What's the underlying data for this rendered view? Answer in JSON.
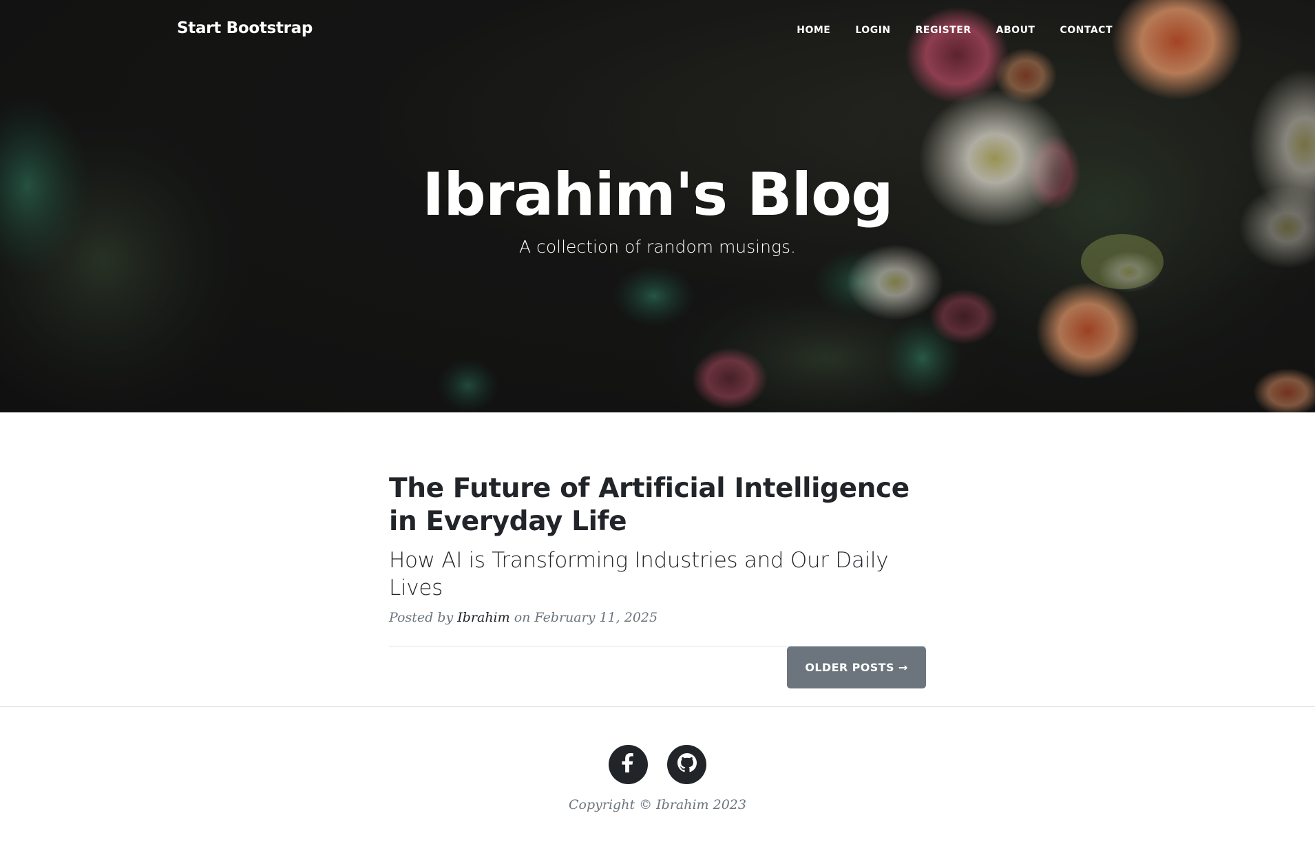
{
  "navbar": {
    "brand": "Start Bootstrap",
    "links": [
      "HOME",
      "LOGIN",
      "REGISTER",
      "ABOUT",
      "CONTACT"
    ]
  },
  "hero": {
    "title": "Ibrahim's Blog",
    "subtitle": "A collection of random musings."
  },
  "posts": [
    {
      "title": "The Future of Artificial Intelligence in Everyday Life",
      "subtitle": "How AI is Transforming Industries and Our Daily Lives",
      "meta_prefix": "Posted by",
      "author": "Ibrahim",
      "meta_suffix": "on February 11, 2025"
    }
  ],
  "pager": {
    "older_label": "OLDER POSTS →"
  },
  "footer": {
    "social": [
      "facebook-icon",
      "github-icon"
    ],
    "copyright": "Copyright © Ibrahim 2023"
  },
  "colors": {
    "text": "#212529",
    "muted": "#6c757d",
    "button": "#6c757d",
    "rule": "#dee2e6"
  }
}
